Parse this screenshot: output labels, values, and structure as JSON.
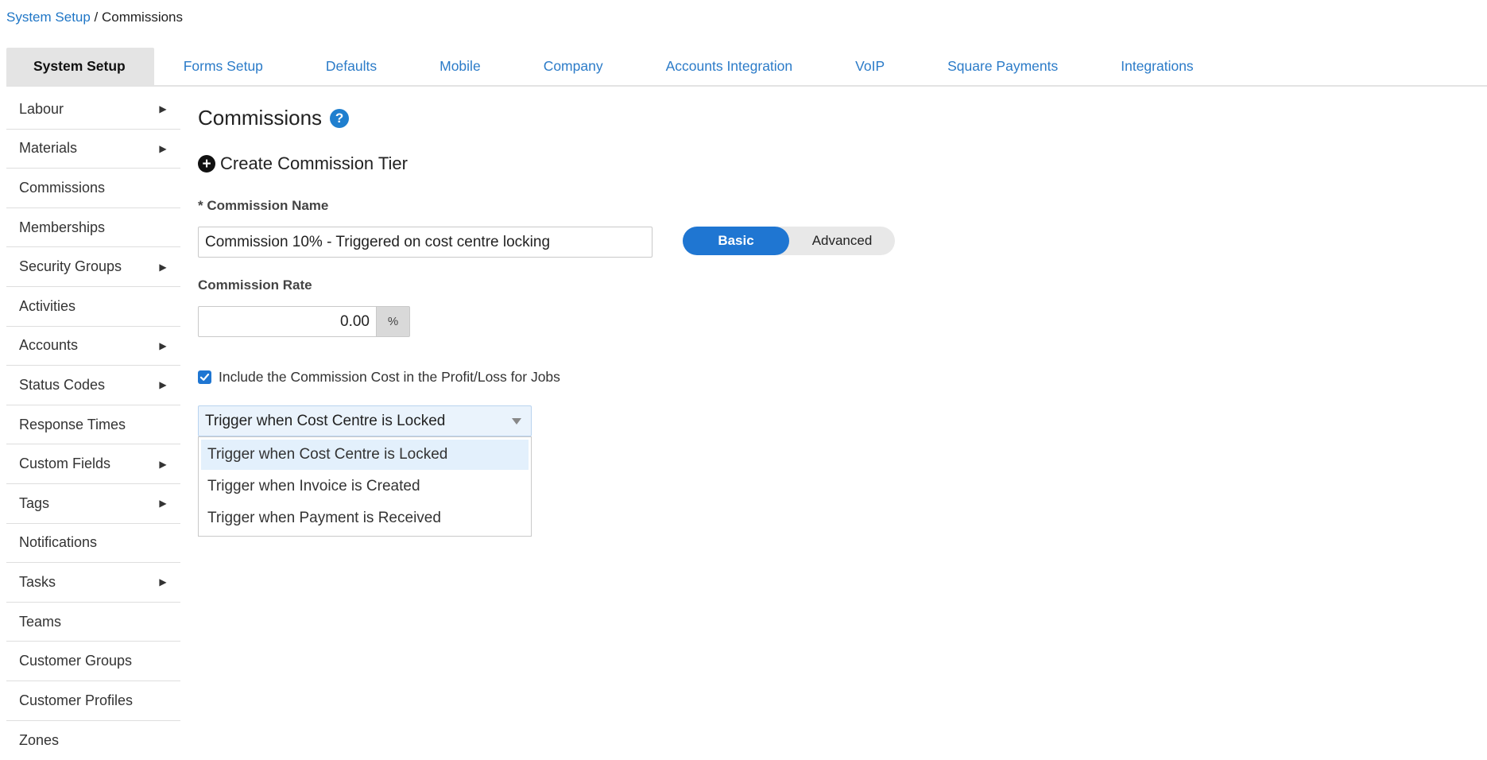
{
  "breadcrumb": {
    "root": "System Setup",
    "separator": " / ",
    "current": "Commissions"
  },
  "tabs": [
    {
      "label": "System Setup",
      "active": true
    },
    {
      "label": "Forms Setup"
    },
    {
      "label": "Defaults"
    },
    {
      "label": "Mobile"
    },
    {
      "label": "Company"
    },
    {
      "label": "Accounts Integration"
    },
    {
      "label": "VoIP"
    },
    {
      "label": "Square Payments"
    },
    {
      "label": "Integrations"
    }
  ],
  "sidebar": {
    "items": [
      {
        "label": "Labour",
        "has_submenu": true
      },
      {
        "label": "Materials",
        "has_submenu": true
      },
      {
        "label": "Commissions",
        "has_submenu": false
      },
      {
        "label": "Memberships",
        "has_submenu": false
      },
      {
        "label": "Security Groups",
        "has_submenu": true
      },
      {
        "label": "Activities",
        "has_submenu": false
      },
      {
        "label": "Accounts",
        "has_submenu": true
      },
      {
        "label": "Status Codes",
        "has_submenu": true
      },
      {
        "label": "Response Times",
        "has_submenu": false
      },
      {
        "label": "Custom Fields",
        "has_submenu": true
      },
      {
        "label": "Tags",
        "has_submenu": true
      },
      {
        "label": "Notifications",
        "has_submenu": false
      },
      {
        "label": "Tasks",
        "has_submenu": true
      },
      {
        "label": "Teams",
        "has_submenu": false
      },
      {
        "label": "Customer Groups",
        "has_submenu": false
      },
      {
        "label": "Customer Profiles",
        "has_submenu": false
      },
      {
        "label": "Zones",
        "has_submenu": false
      }
    ],
    "arrow_glyph": "▶"
  },
  "main": {
    "title": "Commissions",
    "help_glyph": "?",
    "create_label": "Create Commission Tier",
    "name_label": "* Commission Name",
    "name_value": "Commission 10% - Triggered on cost centre locking",
    "mode_toggle": {
      "basic": "Basic",
      "advanced": "Advanced",
      "selected": "Basic"
    },
    "rate_label": "Commission Rate",
    "rate_value": "0.00",
    "rate_unit": "%",
    "include_cost_label": "Include the Commission Cost in the Profit/Loss for Jobs",
    "include_cost_checked": true,
    "trigger_selected": "Trigger when Cost Centre is Locked",
    "trigger_options": [
      "Trigger when Cost Centre is Locked",
      "Trigger when Invoice is Created",
      "Trigger when Payment is Received"
    ]
  },
  "colors": {
    "link": "#1f76c6",
    "accent": "#1f76d2",
    "tab_active_bg": "#e4e4e4"
  }
}
